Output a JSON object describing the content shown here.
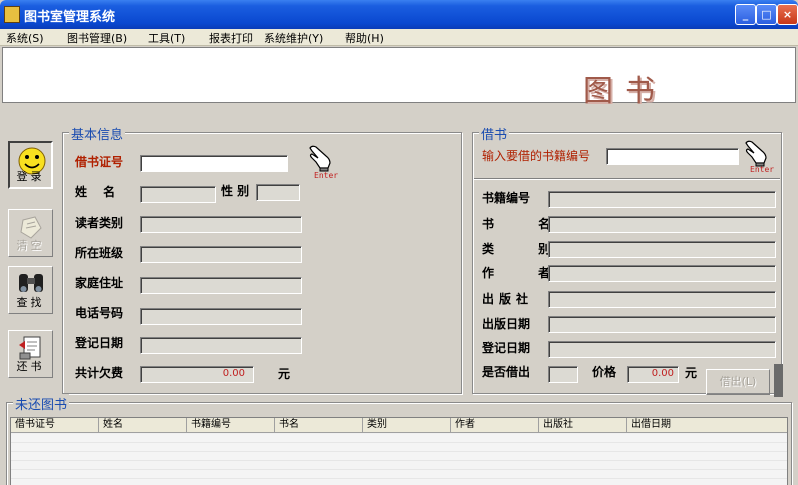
{
  "window": {
    "title": "图书室管理系统",
    "min": "_",
    "max": "□",
    "close": "×"
  },
  "menu": [
    "系统(S)",
    "图书管理(B)",
    "工具(T)",
    "报表打印",
    "系统维护(Y)",
    "帮助(H)"
  ],
  "banner": {
    "title": "图书"
  },
  "sidebar": [
    {
      "label": "登录"
    },
    {
      "label": "清空"
    },
    {
      "label": "查找"
    },
    {
      "label": "还书"
    }
  ],
  "basic": {
    "legend": "基本信息",
    "card_label": "借书证号",
    "name_label": "姓 名",
    "gender_label": "性 别",
    "reader_type_label": "读者类别",
    "class_label": "所在班级",
    "address_label": "家庭住址",
    "phone_label": "电话号码",
    "reg_date_label": "登记日期",
    "debt_label": "共计欠费",
    "debt_value": "0.00",
    "debt_unit": "元",
    "enter_text": "Enter"
  },
  "borrow": {
    "legend": "借书",
    "prompt": "输入要借的书籍编号",
    "enter_text": "Enter",
    "book_no_label": "书籍编号",
    "book_name_label": "书 名",
    "category_label": "类 别",
    "author_label": "作 者",
    "publisher_label": "出版社",
    "pub_date_label": "出版日期",
    "reg_date_label": "登记日期",
    "lent_label": "是否借出",
    "price_label": "价格",
    "price_value": "0.00",
    "price_unit": "元",
    "borrow_button": "借出(L)"
  },
  "unreturned": {
    "legend": "未还图书",
    "columns": [
      "借书证号",
      "姓名",
      "书籍编号",
      "书名",
      "类别",
      "作者",
      "出版社",
      "出借日期"
    ]
  }
}
